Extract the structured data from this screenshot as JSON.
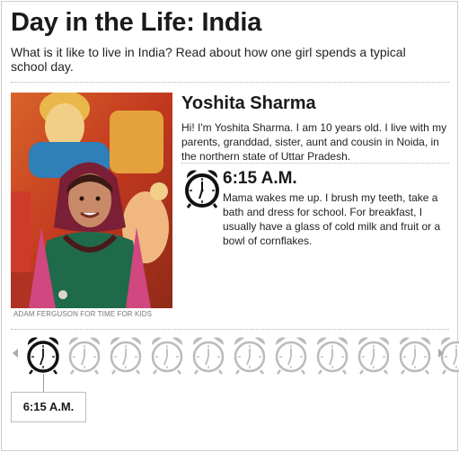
{
  "header": {
    "title": "Day in the Life: India",
    "intro": "What is it like to live in India? Read about how one girl spends a typical school day."
  },
  "photo": {
    "credit": "ADAM FERGUSON FOR TIME FOR KIDS"
  },
  "profile": {
    "name": "Yoshita Sharma",
    "bio": "Hi! I'm Yoshita Sharma. I am 10 years old. I live with my parents, granddad, sister, aunt and cousin in Noida, in the northern state of Uttar Pradesh."
  },
  "entry": {
    "time": "6:15 A.M.",
    "text": "Mama wakes me up. I brush my teeth, take a bath and dress for school. For breakfast, I usually have a glass of cold milk and fruit or a bowl of cornflakes."
  },
  "timeline": {
    "clock_count": 11,
    "active_index": 0,
    "active_time": "6:15 A.M."
  },
  "colors": {
    "active_clock": "#111111",
    "inactive_clock": "#bbbbbb",
    "arrow": "#aaaaaa"
  },
  "icons": {
    "prev": "triangle-left-icon",
    "next": "triangle-right-icon",
    "clock": "alarm-clock-icon"
  }
}
